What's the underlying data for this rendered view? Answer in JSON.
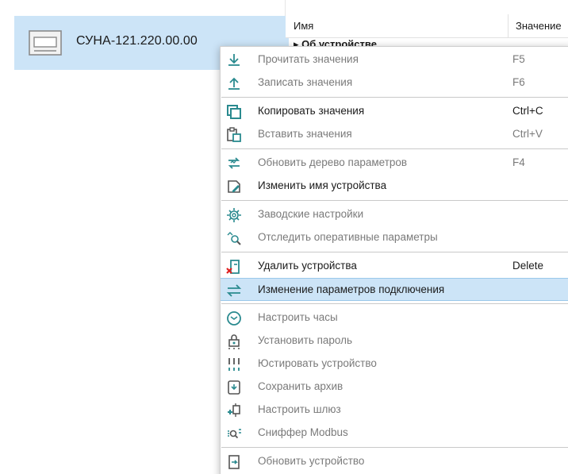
{
  "device_tree": {
    "device_name": "СУНА-121.220.00.00"
  },
  "table": {
    "col_name": "Имя",
    "col_value": "Значение",
    "first_row": "Об устройстве"
  },
  "context_menu": {
    "groups": [
      [
        {
          "label": "Прочитать значения",
          "shortcut": "F5",
          "icon": "download-arrow-icon",
          "enabled": false
        },
        {
          "label": "Записать значения",
          "shortcut": "F6",
          "icon": "upload-arrow-icon",
          "enabled": false
        }
      ],
      [
        {
          "label": "Копировать значения",
          "shortcut": "Ctrl+C",
          "icon": "copy-icon",
          "enabled": true
        },
        {
          "label": "Вставить значения",
          "shortcut": "Ctrl+V",
          "icon": "paste-icon",
          "enabled": false
        }
      ],
      [
        {
          "label": "Обновить дерево параметров",
          "shortcut": "F4",
          "icon": "refresh-tree-icon",
          "enabled": false
        },
        {
          "label": "Изменить имя устройства",
          "shortcut": "",
          "icon": "rename-icon",
          "enabled": true
        }
      ],
      [
        {
          "label": "Заводские настройки",
          "shortcut": "",
          "icon": "factory-settings-icon",
          "enabled": false
        },
        {
          "label": "Отследить оперативные параметры",
          "shortcut": "",
          "icon": "monitor-icon",
          "enabled": false
        }
      ],
      [
        {
          "label": "Удалить устройства",
          "shortcut": "Delete",
          "icon": "delete-device-icon",
          "enabled": true
        },
        {
          "label": "Изменение параметров подключения",
          "shortcut": "",
          "icon": "connection-icon",
          "enabled": true,
          "highlighted": true
        }
      ],
      [
        {
          "label": "Настроить часы",
          "shortcut": "",
          "icon": "clock-icon",
          "enabled": false
        },
        {
          "label": "Установить пароль",
          "shortcut": "",
          "icon": "password-icon",
          "enabled": false
        },
        {
          "label": "Юстировать устройство",
          "shortcut": "",
          "icon": "calibrate-icon",
          "enabled": false
        },
        {
          "label": "Сохранить архив",
          "shortcut": "",
          "icon": "save-archive-icon",
          "enabled": false
        },
        {
          "label": "Настроить шлюз",
          "shortcut": "",
          "icon": "gateway-icon",
          "enabled": false
        },
        {
          "label": "Сниффер Modbus",
          "shortcut": "",
          "icon": "sniffer-icon",
          "enabled": false
        }
      ],
      [
        {
          "label": "Обновить устройство",
          "shortcut": "",
          "icon": "update-device-icon",
          "enabled": false
        }
      ]
    ]
  }
}
